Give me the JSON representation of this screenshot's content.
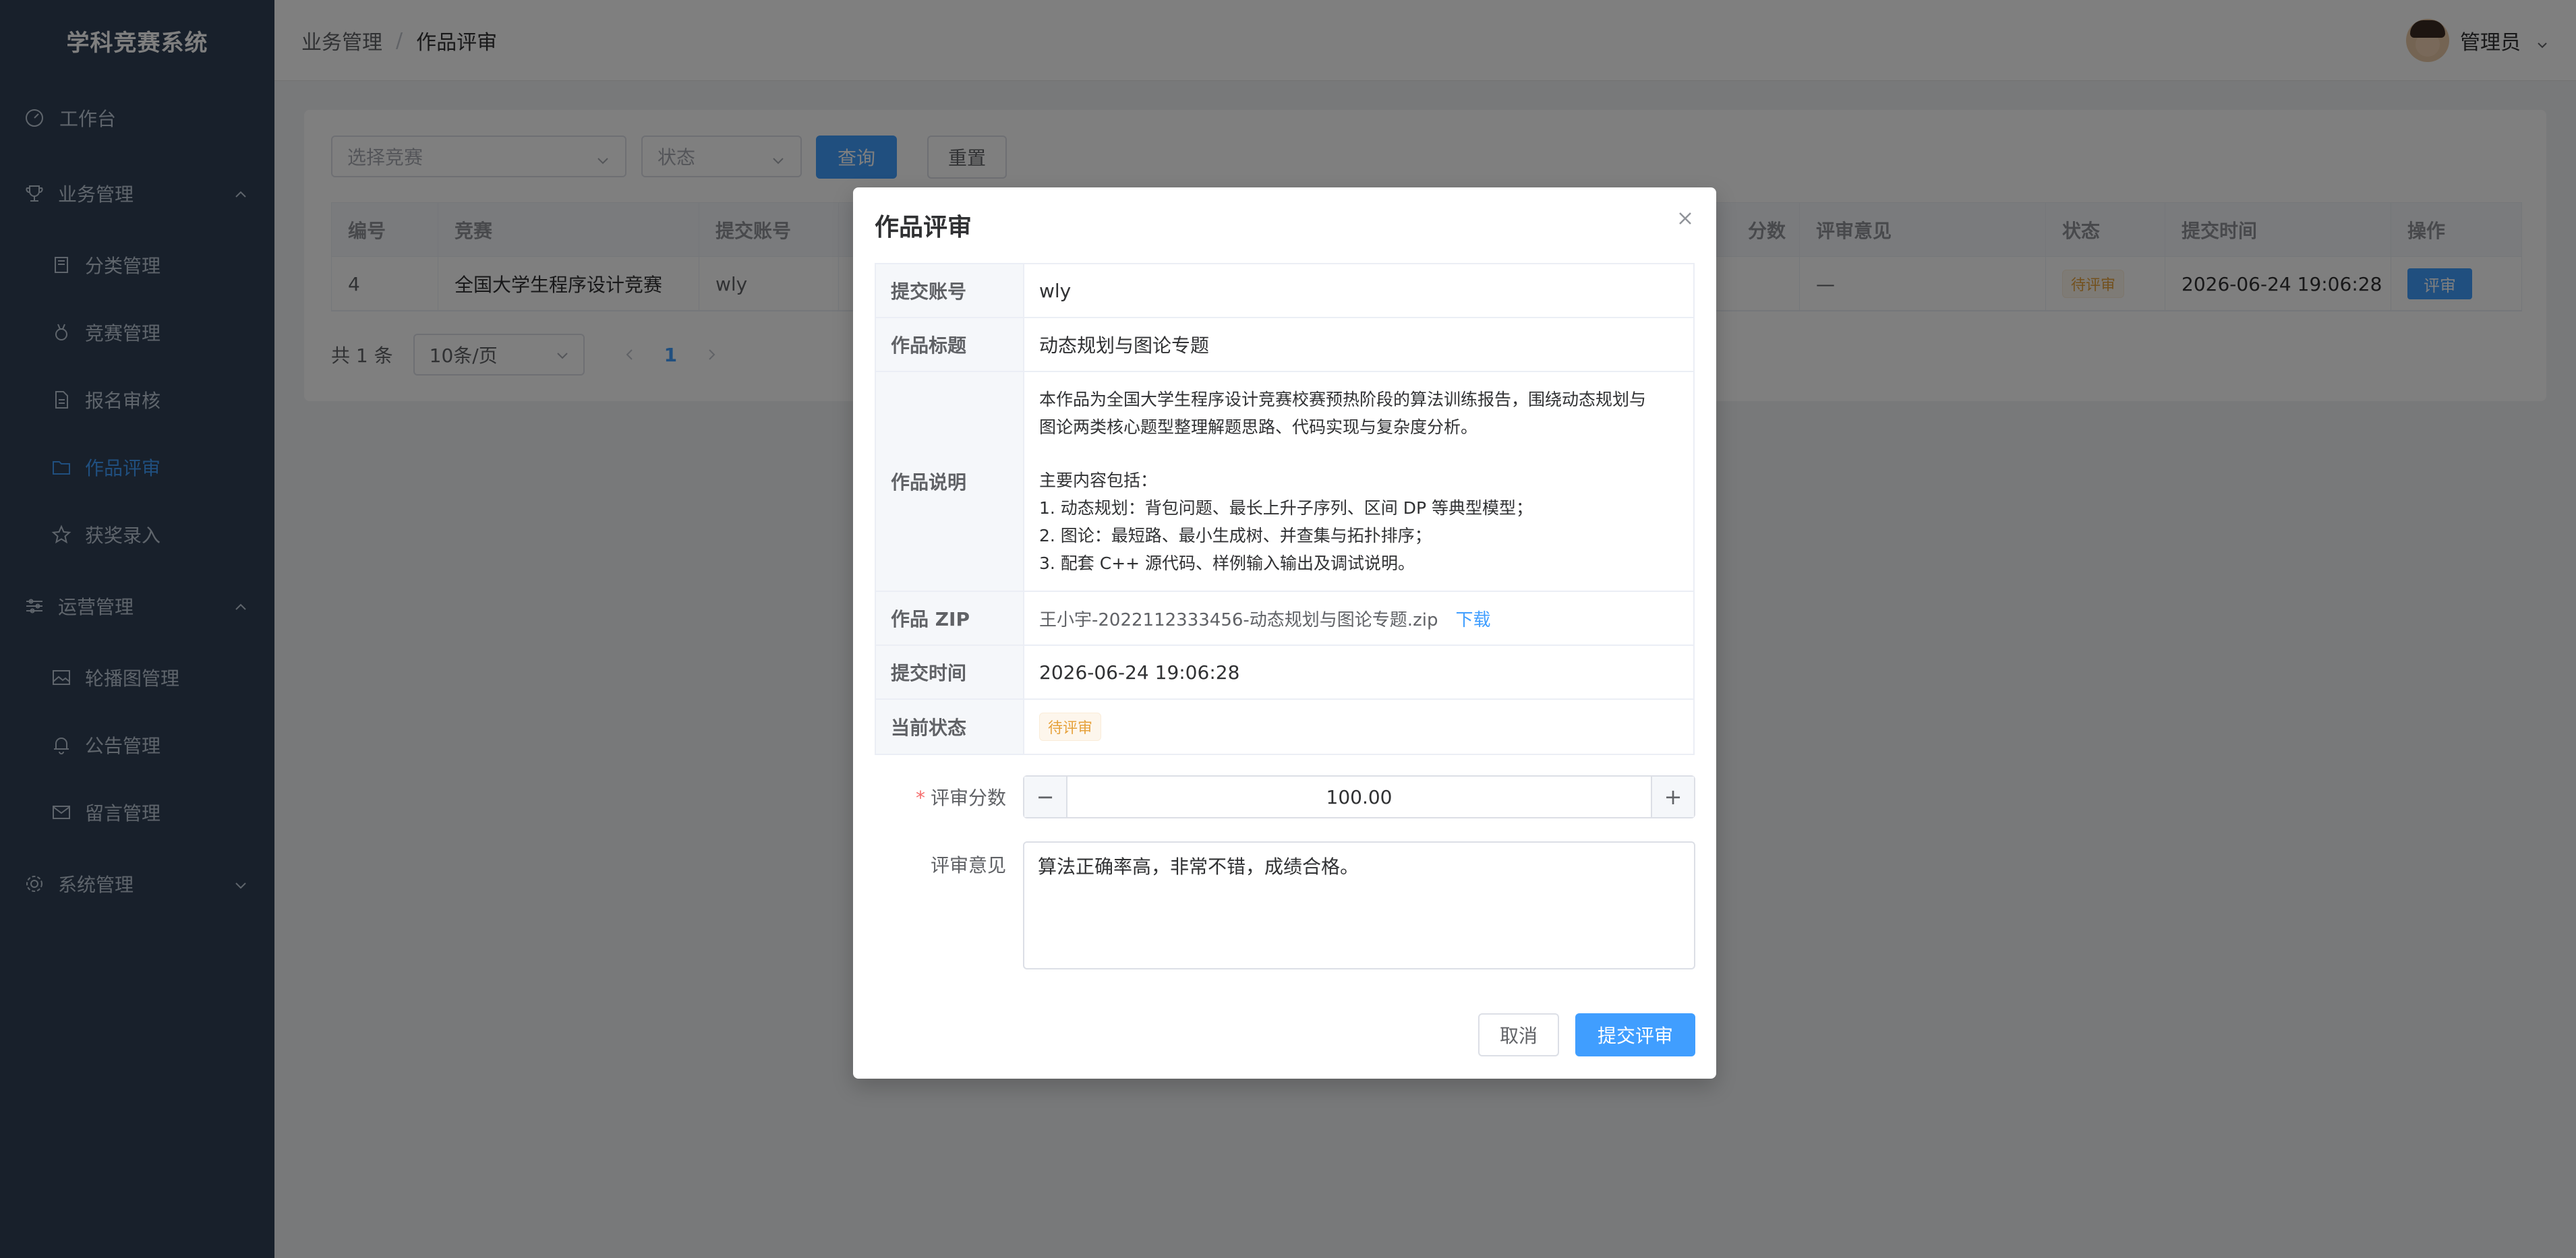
{
  "app": {
    "title": "学科竞赛系统"
  },
  "sidebar": {
    "items": [
      {
        "label": "工作台",
        "icon": "dashboard-icon"
      },
      {
        "label": "业务管理",
        "icon": "trophy-icon"
      },
      {
        "label": "分类管理",
        "icon": "category-icon"
      },
      {
        "label": "竞赛管理",
        "icon": "medal-icon"
      },
      {
        "label": "报名审核",
        "icon": "document-icon"
      },
      {
        "label": "作品评审",
        "icon": "folder-icon",
        "active": true
      },
      {
        "label": "获奖录入",
        "icon": "star-icon"
      },
      {
        "label": "运营管理",
        "icon": "sliders-icon"
      },
      {
        "label": "轮播图管理",
        "icon": "image-icon"
      },
      {
        "label": "公告管理",
        "icon": "bell-icon"
      },
      {
        "label": "留言管理",
        "icon": "mail-icon"
      },
      {
        "label": "系统管理",
        "icon": "gear-icon"
      }
    ]
  },
  "header": {
    "breadcrumb": [
      "业务管理",
      "作品评审"
    ],
    "separator": "/",
    "user": "管理员"
  },
  "filters": {
    "competition_placeholder": "选择竞赛",
    "status_placeholder": "状态",
    "query_label": "查询",
    "reset_label": "重置"
  },
  "table": {
    "columns": [
      "编号",
      "竞赛",
      "提交账号",
      "分数",
      "评审意见",
      "状态",
      "提交时间",
      "操作"
    ],
    "rows": [
      {
        "id": "4",
        "competition": "全国大学生程序设计竞赛",
        "account": "wly",
        "opinion": "—",
        "status": "待评审",
        "time": "2026-06-24 19:06:28",
        "action": "评审"
      }
    ]
  },
  "pager": {
    "total": "共 1 条",
    "page_size": "10条/页",
    "current": "1"
  },
  "dialog": {
    "title": "作品评审",
    "fields": {
      "account_label": "提交账号",
      "account": "wly",
      "title_label": "作品标题",
      "title": "动态规划与图论专题",
      "desc_label": "作品说明",
      "desc_lines": [
        "本作品为全国大学生程序设计竞赛校赛预热阶段的算法训练报告，围绕动态规划与",
        "图论两类核心题型整理解题思路、代码实现与复杂度分析。",
        "主要内容包括：",
        "1. 动态规划：背包问题、最长上升子序列、区间 DP 等典型模型；",
        "2. 图论：最短路、最小生成树、并查集与拓扑排序；",
        "3. 配套 C++ 源代码、样例输入输出及调试说明。"
      ],
      "zip_label": "作品 ZIP",
      "zip_file": "王小宇-2022112333456-动态规划与图论专题.zip",
      "download": "下载",
      "time_label": "提交时间",
      "time": "2026-06-24 19:06:28",
      "status_label": "当前状态",
      "status": "待评审"
    },
    "form": {
      "score_label": "评审分数",
      "required_mark": "*",
      "score": "100.00",
      "minus": "−",
      "plus": "+",
      "opinion_label": "评审意见",
      "opinion": "算法正确率高，非常不错，成绩合格。"
    },
    "cancel_label": "取消",
    "submit_label": "提交评审"
  },
  "colors": {
    "sidebar_bg": "#304156",
    "primary": "#409eff",
    "warning": "#e6a23c"
  }
}
